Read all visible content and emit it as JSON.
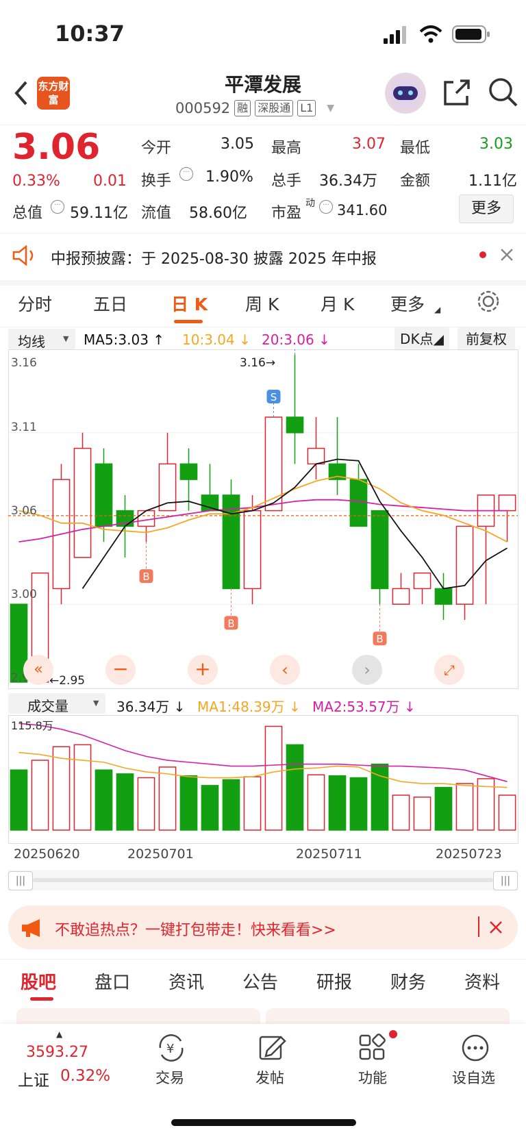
{
  "status": {
    "time": "10:37"
  },
  "header": {
    "logo": "东方财富",
    "title": "平潭发展",
    "code": "000592",
    "tags": [
      "融",
      "深股通",
      "L1"
    ]
  },
  "quote": {
    "price": "3.06",
    "pct": "0.33%",
    "change": "0.01",
    "items": [
      {
        "label": "今开",
        "value": "3.05"
      },
      {
        "label": "最高",
        "value": "3.07"
      },
      {
        "label": "最低",
        "value": "3.03"
      },
      {
        "label": "换手",
        "value": "1.90%"
      },
      {
        "label": "总手",
        "value": "36.34万"
      },
      {
        "label": "金额",
        "value": "1.11亿"
      },
      {
        "label": "总值",
        "value": "59.11亿"
      },
      {
        "label": "流值",
        "value": "58.60亿"
      },
      {
        "label": "市盈",
        "value": "341.60",
        "sup": "动"
      }
    ],
    "more": "更多"
  },
  "notice": {
    "text": "中报预披露：于 2025-08-30 披露 2025 年中报"
  },
  "tabs": [
    "分时",
    "五日",
    "日 K",
    "周 K",
    "月 K",
    "更多"
  ],
  "active_tab": "日 K",
  "ma_bar": {
    "select": "均线",
    "ma5": "MA5:3.03",
    "ma10": "10:3.04",
    "ma20": "20:3.06",
    "dk": "DK点",
    "adjust": "前复权"
  },
  "vol_bar": {
    "select": "成交量",
    "vol": "36.34万",
    "ma1": "MA1:48.39万",
    "ma2": "MA2:53.57万"
  },
  "banner": {
    "text": "不敢追热点？一键打包带走！快来看看>>"
  },
  "bottom_tabs": [
    "股吧",
    "盘口",
    "资讯",
    "公告",
    "研报",
    "财务",
    "资料"
  ],
  "footer": {
    "index_value": "3593.27",
    "index_name": "上证",
    "index_pct": "0.32%",
    "items": [
      {
        "label": "交易",
        "icon": "yen-exchange-icon"
      },
      {
        "label": "发帖",
        "icon": "edit-icon"
      },
      {
        "label": "功能",
        "icon": "grid-icon"
      },
      {
        "label": "设自选",
        "icon": "more-icon"
      }
    ]
  },
  "colors": {
    "up": "#e0242e",
    "down": "#12a012",
    "ma5": "#111111",
    "ma10": "#f5a623",
    "ma20": "#d61fa6",
    "accent": "#f25a14"
  },
  "chart_data": {
    "type": "candlestick",
    "price_axis_labels": [
      "3.16",
      "3.11",
      "3.06",
      "3.00",
      "2.95"
    ],
    "ylim": [
      2.95,
      3.16
    ],
    "high_marker": "3.16→",
    "low_marker": "←2.95",
    "x_labels": [
      "20250620",
      "20250701",
      "20250711",
      "20250723"
    ],
    "volume_axis_label": "115.8万",
    "candles": [
      {
        "o": 3.0,
        "h": 3.0,
        "l": 2.95,
        "c": 2.95
      },
      {
        "o": 2.95,
        "h": 3.02,
        "l": 2.95,
        "c": 3.02
      },
      {
        "o": 3.01,
        "h": 3.09,
        "l": 3.0,
        "c": 3.08
      },
      {
        "o": 3.03,
        "h": 3.11,
        "l": 3.03,
        "c": 3.1
      },
      {
        "o": 3.09,
        "h": 3.1,
        "l": 3.04,
        "c": 3.05
      },
      {
        "o": 3.06,
        "h": 3.07,
        "l": 3.03,
        "c": 3.05
      },
      {
        "o": 3.05,
        "h": 3.06,
        "l": 3.04,
        "c": 3.06
      },
      {
        "o": 3.06,
        "h": 3.11,
        "l": 3.06,
        "c": 3.09
      },
      {
        "o": 3.09,
        "h": 3.1,
        "l": 3.06,
        "c": 3.08
      },
      {
        "o": 3.07,
        "h": 3.09,
        "l": 3.06,
        "c": 3.06
      },
      {
        "o": 3.07,
        "h": 3.08,
        "l": 3.01,
        "c": 3.01
      },
      {
        "o": 3.01,
        "h": 3.07,
        "l": 3.0,
        "c": 3.06
      },
      {
        "o": 3.06,
        "h": 3.12,
        "l": 3.06,
        "c": 3.12
      },
      {
        "o": 3.12,
        "h": 3.16,
        "l": 3.09,
        "c": 3.11
      },
      {
        "o": 3.09,
        "h": 3.12,
        "l": 3.08,
        "c": 3.1
      },
      {
        "o": 3.09,
        "h": 3.12,
        "l": 3.07,
        "c": 3.08
      },
      {
        "o": 3.08,
        "h": 3.09,
        "l": 3.05,
        "c": 3.05
      },
      {
        "o": 3.06,
        "h": 3.06,
        "l": 3.0,
        "c": 3.01
      },
      {
        "o": 3.0,
        "h": 3.02,
        "l": 3.0,
        "c": 3.01
      },
      {
        "o": 3.01,
        "h": 3.02,
        "l": 3.0,
        "c": 3.02
      },
      {
        "o": 3.01,
        "h": 3.02,
        "l": 2.99,
        "c": 3.0
      },
      {
        "o": 3.0,
        "h": 3.05,
        "l": 2.99,
        "c": 3.05
      },
      {
        "o": 3.05,
        "h": 3.07,
        "l": 3.0,
        "c": 3.07
      },
      {
        "o": 3.06,
        "h": 3.07,
        "l": 3.04,
        "c": 3.07
      }
    ],
    "ma5": [
      null,
      null,
      null,
      3.01,
      3.03,
      3.05,
      3.06,
      3.065,
      3.066,
      3.062,
      3.058,
      3.06,
      3.065,
      3.075,
      3.09,
      3.093,
      3.092,
      3.066,
      3.047,
      3.03,
      3.01,
      3.012,
      3.028,
      3.036
    ],
    "ma10": [
      3.06,
      3.057,
      3.052,
      3.052,
      3.048,
      3.047,
      3.046,
      3.049,
      3.054,
      3.058,
      3.058,
      3.062,
      3.068,
      3.074,
      3.079,
      3.082,
      3.08,
      3.074,
      3.065,
      3.06,
      3.057,
      3.052,
      3.047,
      3.04
    ],
    "ma20": [
      3.04,
      3.042,
      3.045,
      3.048,
      3.05,
      3.052,
      3.054,
      3.056,
      3.058,
      3.06,
      3.061,
      3.062,
      3.064,
      3.066,
      3.067,
      3.067,
      3.066,
      3.064,
      3.063,
      3.062,
      3.061,
      3.06,
      3.06,
      3.06
    ],
    "buy_sell_markers": [
      {
        "type": "B",
        "index": 6
      },
      {
        "type": "B",
        "index": 10
      },
      {
        "type": "S",
        "index": 12
      },
      {
        "type": "S",
        "index": 13
      },
      {
        "type": "B",
        "index": 17
      }
    ],
    "volume": [
      62,
      72,
      86,
      88,
      62,
      58,
      54,
      65,
      56,
      46,
      52,
      55,
      107,
      88,
      57,
      56,
      54,
      68,
      36,
      34,
      44,
      48,
      53,
      36
    ],
    "vol_ma1": [
      80,
      78,
      74,
      72,
      70,
      64,
      60,
      58,
      55,
      54,
      54,
      55,
      60,
      63,
      64,
      66,
      65,
      56,
      50,
      48,
      48,
      46,
      45,
      44
    ],
    "vol_ma2": [
      110,
      108,
      104,
      98,
      90,
      82,
      76,
      72,
      70,
      68,
      66,
      66,
      67,
      68,
      68,
      68,
      67,
      66,
      66,
      65,
      64,
      62,
      56,
      50
    ],
    "vol_max": 115.8
  }
}
